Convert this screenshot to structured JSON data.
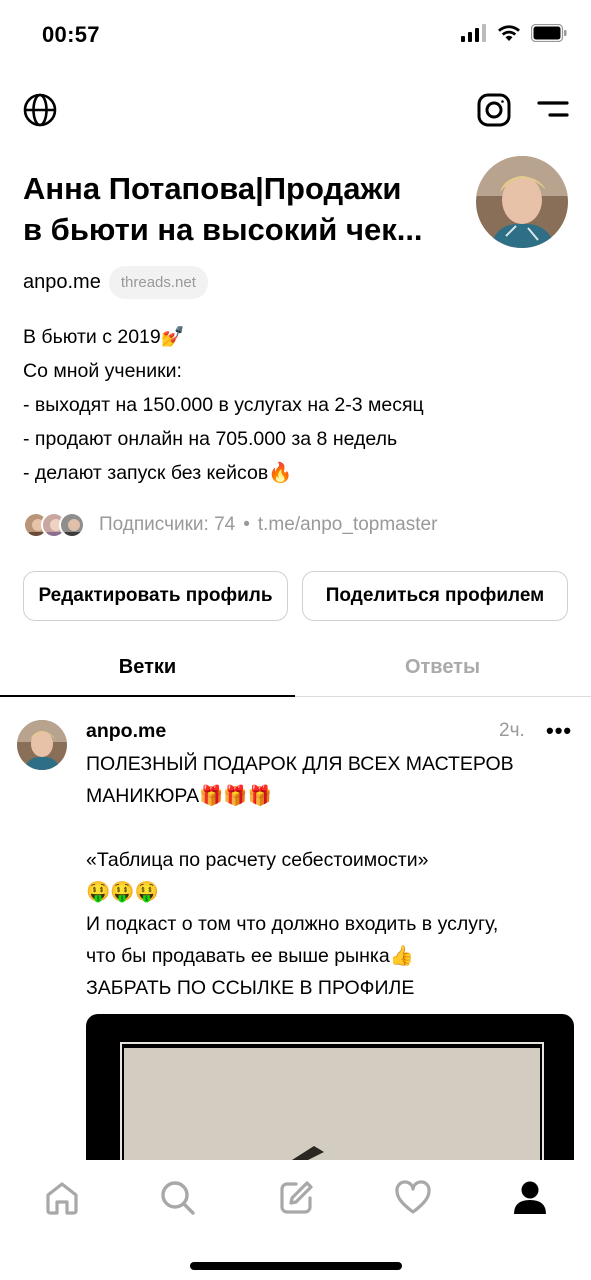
{
  "status_bar": {
    "time": "00:57"
  },
  "profile": {
    "name": "Анна Потапова|Продажи\nв бьюти на высокий чек...",
    "username": "anpo.me",
    "domain_badge": "threads.net",
    "bio": [
      "В бьюти с 2019💅",
      "Со мной ученики:",
      "- выходят на 150.000 в услугах на 2-3 месяц",
      "- продают онлайн на 705.000 за 8 недель",
      "- делают запуск без кейсов🔥"
    ],
    "followers_label": "Подписчики: 74",
    "separator": "•",
    "link": "t.me/anpo_topmaster",
    "edit_button": "Редактировать профиль",
    "share_button": "Поделиться профилем"
  },
  "tabs": {
    "threads": "Ветки",
    "replies": "Ответы"
  },
  "post": {
    "author": "anpo.me",
    "time": "2ч.",
    "more": "•••",
    "lines": [
      "ПОЛЕЗНЫЙ ПОДАРОК ДЛЯ ВСЕХ МАСТЕРОВ",
      "МАНИКЮРА🎁🎁🎁",
      "",
      "«Таблица по расчету себестоимости»",
      "🤑🤑🤑",
      "И подкаст о том что должно входить в услугу,",
      "что бы продавать ее выше рынка👍",
      "ЗАБРАТЬ ПО ССЫЛКЕ В ПРОФИЛЕ"
    ]
  },
  "bottom_nav": {
    "items": [
      "home-icon",
      "search-icon",
      "compose-icon",
      "heart-icon",
      "profile-icon"
    ],
    "active": "profile-icon"
  }
}
